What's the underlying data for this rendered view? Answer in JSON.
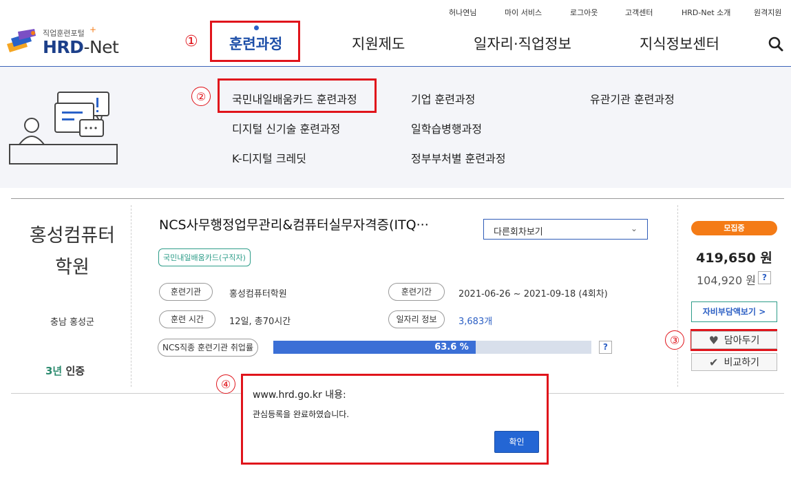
{
  "utility_nav": [
    "허나연님",
    "마이 서비스",
    "로그아웃",
    "고객센터",
    "HRD-Net 소개",
    "원격지원"
  ],
  "logo": {
    "small": "직업훈련포털",
    "brand_a": "HRD",
    "brand_b": "-Net"
  },
  "main_nav": [
    "훈련과정",
    "지원제도",
    "일자리·직업정보",
    "지식정보센터"
  ],
  "annotations": [
    "①",
    "②",
    "③",
    "④"
  ],
  "submenu": [
    "국민내일배움카드 훈련과정",
    "기업 훈련과정",
    "유관기관 훈련과정",
    "디지털 신기술 훈련과정",
    "일학습병행과정",
    "K-디지털 크레딧",
    "정부부처별 훈련과정"
  ],
  "course": {
    "institution": {
      "name_line1": "홍성컴퓨터",
      "name_line2": "학원",
      "location": "충남 홍성군",
      "cert_num": "3년",
      "cert_label": "인증"
    },
    "title": "NCS사무행정업무관리&컴퓨터실무자격증(ITQ···",
    "other_rounds_select": "다른회차보기",
    "tag": "국민내일배움카드(구직자)",
    "info": [
      {
        "label": "훈련기관",
        "value": "홍성컴퓨터학원"
      },
      {
        "label": "훈련기간",
        "value": "2021-06-26 ~ 2021-09-18 (4회차)"
      },
      {
        "label": "훈련 시간",
        "value": "12일, 총70시간"
      },
      {
        "label": "일자리 정보",
        "value": "3,683개"
      }
    ],
    "employment_rate": {
      "label": "NCS직종 훈련기관 취업률",
      "text": "63.6 %",
      "percent": 63.6
    },
    "help_glyph": "?",
    "status": "모집중",
    "price": "419,650 원",
    "self_pay": "104,920 원",
    "self_pay_button": "자비부담액보기 >",
    "wishlist_button": "담아두기",
    "compare_button": "비교하기"
  },
  "dialog": {
    "title": "www.hrd.go.kr 내용:",
    "message": "관심등록을 완료하였습니다.",
    "ok_button": "확인"
  },
  "colors": {
    "accent_blue": "#1c4ea8",
    "annotation_red": "#e0141b",
    "status_orange": "#f47b16",
    "progress_blue": "#3b6fd6"
  }
}
